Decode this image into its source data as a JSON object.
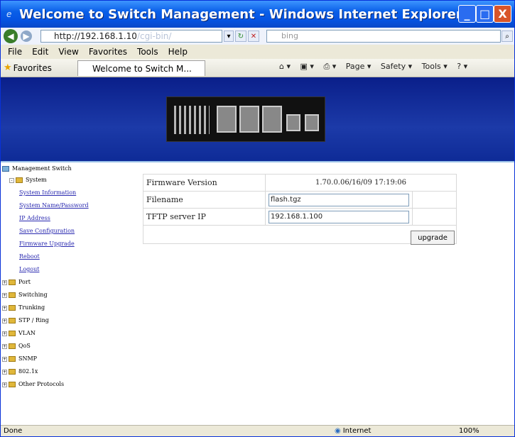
{
  "window": {
    "title": "Welcome to Switch Management - Windows Internet Explorer",
    "min_glyph": "_",
    "max_glyph": "□",
    "close_glyph": "X"
  },
  "address": {
    "url_main": "http://192.168.1.10",
    "url_dim": "/cgi-bin/",
    "search_placeholder": "bing"
  },
  "menu": [
    "File",
    "Edit",
    "View",
    "Favorites",
    "Tools",
    "Help"
  ],
  "favorites_bar": {
    "favorites_label": "Favorites",
    "tab_title": "Welcome to Switch M...",
    "commands": [
      "Page ▾",
      "Safety ▾",
      "Tools ▾"
    ]
  },
  "sidebar": {
    "root": "Management Switch",
    "system": "System",
    "system_links": [
      "System Information",
      "System Name/Password",
      "IP Address",
      "Save Configuration",
      "Firmware Upgrade",
      "Reboot",
      "Logout"
    ],
    "folders": [
      "Port",
      "Switching",
      "Trunking",
      "STP / Ring",
      "VLAN",
      "QoS",
      "SNMP",
      "802.1x",
      "Other Protocols"
    ]
  },
  "form": {
    "firmware_label": "Firmware Version",
    "firmware_value": "1.70.0.06/16/09 17:19:06",
    "filename_label": "Filename",
    "filename_value": "flash.tgz",
    "tftp_label": "TFTP server IP",
    "tftp_value": "192.168.1.100",
    "upgrade_label": "upgrade"
  },
  "status": {
    "left": "Done",
    "zone": "Internet",
    "zoom": "100%"
  },
  "colors": {
    "title_blue": "#0554e3",
    "banner_blue": "#1c3aa8",
    "link_blue": "#2a2ab0",
    "close_red": "#d8552a"
  }
}
